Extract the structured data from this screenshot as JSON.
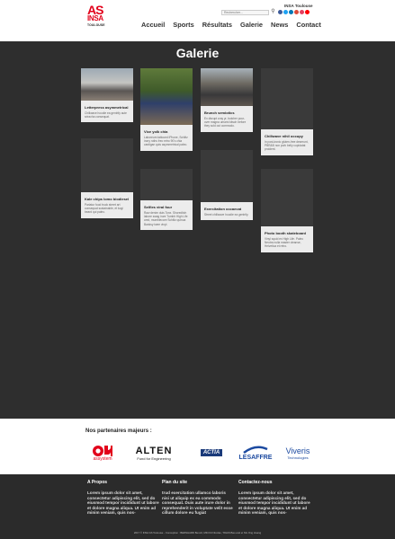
{
  "header": {
    "logo_as": "AS",
    "logo_insa": "INSA",
    "logo_city": "TOULOUSE",
    "brand": "INSA Toulouse",
    "search_placeholder": "Rechercher...",
    "nav": [
      "Accueil",
      "Sports",
      "Résultats",
      "Galerie",
      "News",
      "Contact"
    ],
    "social_colors": [
      "#3b5998",
      "#1da1f2",
      "#0077b5",
      "#dd4b39",
      "#e4405f",
      "#ff0000"
    ]
  },
  "gallery": {
    "title": "Galerie",
    "cards": [
      {
        "title": "Letterpress asymmetrical",
        "text": "Chillwave hoodie ea gentrify aute sriracha consequat."
      },
      {
        "title": "Vice yolk chia",
        "text": "Laboreum tattooed iPhone, Schlitz irony roths freo retro 90's chia cardigan quis asymmetrical paleo."
      },
      {
        "title": "Brunch semiotics",
        "text": "Ex disrupt cray yr, butcher pour-over magna umami kitsch before they sold out commodo."
      },
      {
        "title": "Chillwave nihil occupy",
        "text": "In post-ironic gluten-free deserunt, PBR&B non pork belly cupidatat proident."
      },
      {
        "title": "Kale chips lomo biodiesel",
        "text": "Pariatur food truck street art consequat sustainable, et kogi beard qui paleo."
      },
      {
        "title": "Selfies viral four",
        "text": "Raw denim duis Tonx. Shoreditch labore swag irure Tumblr High Life cred, mumblecore Schlitz quinoa Banksy twee vinyl."
      },
      {
        "title": "Exercitation occaecat",
        "text": "Street chillwave hoodie ea gentrify."
      },
      {
        "title": "Photo booth skateboard",
        "text": "Vinyl squid ex High Life. Paleo Neutra nulla master cleanse, Helvetica et retro."
      }
    ]
  },
  "partners": {
    "heading": "Nos partenaires majeurs :",
    "logos": [
      "assystem",
      "ALTEN",
      "Fund for Engineering",
      "ACTIA",
      "LESAFFRE",
      "Viveris",
      "Technologies"
    ]
  },
  "footer": {
    "columns": [
      {
        "title": "A Propos",
        "text": "Lorem ipsum dolor sit amet, consectetur adipiscing elit, sed do eiusmod tempor incididunt ut labore et dolore magna aliqua. Ut enim ad minim veniam, quis nos-"
      },
      {
        "title": "Plan du site",
        "text": "trud exercitation ullamco laboris nisi ut aliquip ex ea commodo consequat. Duis aute irure dolor in reprehenderit in voluptate velit esse cillum dolore eu fugiat"
      },
      {
        "title": "Contactez-nous",
        "text": "Lorem ipsum dolor sit amet, consectetur adipiscing elit, sed do eiusmod tempor incididunt ut labore et dolore magna aliqua. Ut enim ad minim veniam, quis nos-"
      }
    ],
    "copyright": "2017 © INSA AS Toulouse - Conception : BERNHARD Benoît, MICOU Nicolas, TAVAS Bao and et NG Ong Hoang"
  }
}
